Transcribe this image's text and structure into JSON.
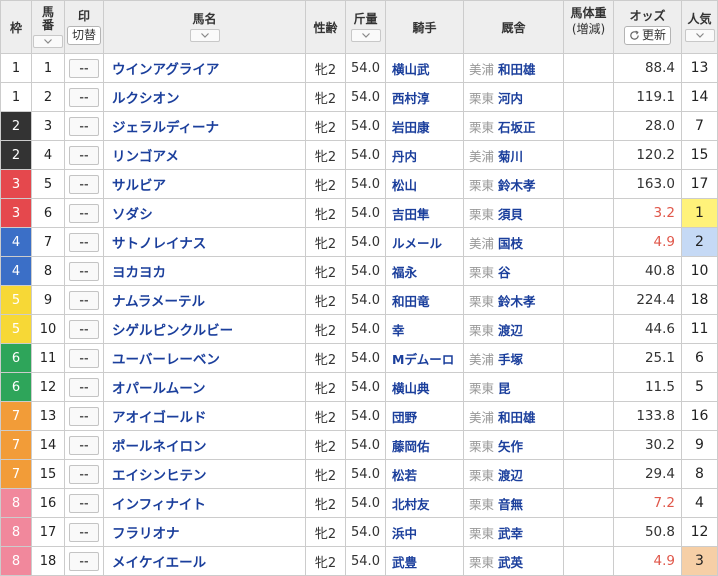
{
  "header": {
    "waku": "枠",
    "umaban": "馬番",
    "mark": "印",
    "mark_toggle": "切替",
    "name": "馬名",
    "sex_age": "性齢",
    "kinryo": "斤量",
    "jockey": "騎手",
    "trainer": "厩舎",
    "weight_l1": "馬体重",
    "weight_l2": "(増減)",
    "odds": "オッズ",
    "refresh": "更新",
    "popularity": "人気"
  },
  "colors": {
    "waku_bg": {
      "1": "#ffffff",
      "2": "#333333",
      "3": "#e5484d",
      "4": "#3b6fc7",
      "5": "#f7d836",
      "6": "#2ea55a",
      "7": "#f29c38",
      "8": "#f1889c"
    },
    "waku_fg": {
      "1": "#222222",
      "2": "#ffffff",
      "3": "#ffffff",
      "4": "#ffffff",
      "5": "#ffffff",
      "6": "#ffffff",
      "7": "#ffffff",
      "8": "#ffffff"
    },
    "pop_bg": {
      "1": "#fff27a",
      "2": "#c5d9f5",
      "3": "#f6cfa6"
    }
  },
  "rows": [
    {
      "waku": "1",
      "umaban": "1",
      "mark": "--",
      "name": "ウインアグライア",
      "sex_age": "牝2",
      "kinryo": "54.0",
      "jockey": "横山武",
      "region": "美浦",
      "trainer": "和田雄",
      "odds": "88.4",
      "pop": "13"
    },
    {
      "waku": "1",
      "umaban": "2",
      "mark": "--",
      "name": "ルクシオン",
      "sex_age": "牝2",
      "kinryo": "54.0",
      "jockey": "西村淳",
      "region": "栗東",
      "trainer": "河内",
      "odds": "119.1",
      "pop": "14"
    },
    {
      "waku": "2",
      "umaban": "3",
      "mark": "--",
      "name": "ジェラルディーナ",
      "sex_age": "牝2",
      "kinryo": "54.0",
      "jockey": "岩田康",
      "region": "栗東",
      "trainer": "石坂正",
      "odds": "28.0",
      "pop": "7"
    },
    {
      "waku": "2",
      "umaban": "4",
      "mark": "--",
      "name": "リンゴアメ",
      "sex_age": "牝2",
      "kinryo": "54.0",
      "jockey": "丹内",
      "region": "美浦",
      "trainer": "菊川",
      "odds": "120.2",
      "pop": "15"
    },
    {
      "waku": "3",
      "umaban": "5",
      "mark": "--",
      "name": "サルビア",
      "sex_age": "牝2",
      "kinryo": "54.0",
      "jockey": "松山",
      "region": "栗東",
      "trainer": "鈴木孝",
      "odds": "163.0",
      "pop": "17"
    },
    {
      "waku": "3",
      "umaban": "6",
      "mark": "--",
      "name": "ソダシ",
      "sex_age": "牝2",
      "kinryo": "54.0",
      "jockey": "吉田隼",
      "region": "栗東",
      "trainer": "須貝",
      "odds": "3.2",
      "pop": "1"
    },
    {
      "waku": "4",
      "umaban": "7",
      "mark": "--",
      "name": "サトノレイナス",
      "sex_age": "牝2",
      "kinryo": "54.0",
      "jockey": "ルメール",
      "region": "美浦",
      "trainer": "国枝",
      "odds": "4.9",
      "pop": "2"
    },
    {
      "waku": "4",
      "umaban": "8",
      "mark": "--",
      "name": "ヨカヨカ",
      "sex_age": "牝2",
      "kinryo": "54.0",
      "jockey": "福永",
      "region": "栗東",
      "trainer": "谷",
      "odds": "40.8",
      "pop": "10"
    },
    {
      "waku": "5",
      "umaban": "9",
      "mark": "--",
      "name": "ナムラメーテル",
      "sex_age": "牝2",
      "kinryo": "54.0",
      "jockey": "和田竜",
      "region": "栗東",
      "trainer": "鈴木孝",
      "odds": "224.4",
      "pop": "18"
    },
    {
      "waku": "5",
      "umaban": "10",
      "mark": "--",
      "name": "シゲルピンクルビー",
      "sex_age": "牝2",
      "kinryo": "54.0",
      "jockey": "幸",
      "region": "栗東",
      "trainer": "渡辺",
      "odds": "44.6",
      "pop": "11"
    },
    {
      "waku": "6",
      "umaban": "11",
      "mark": "--",
      "name": "ユーバーレーベン",
      "sex_age": "牝2",
      "kinryo": "54.0",
      "jockey": "Mデムーロ",
      "region": "美浦",
      "trainer": "手塚",
      "odds": "25.1",
      "pop": "6"
    },
    {
      "waku": "6",
      "umaban": "12",
      "mark": "--",
      "name": "オパールムーン",
      "sex_age": "牝2",
      "kinryo": "54.0",
      "jockey": "横山典",
      "region": "栗東",
      "trainer": "昆",
      "odds": "11.5",
      "pop": "5"
    },
    {
      "waku": "7",
      "umaban": "13",
      "mark": "--",
      "name": "アオイゴールド",
      "sex_age": "牝2",
      "kinryo": "54.0",
      "jockey": "団野",
      "region": "美浦",
      "trainer": "和田雄",
      "odds": "133.8",
      "pop": "16"
    },
    {
      "waku": "7",
      "umaban": "14",
      "mark": "--",
      "name": "ポールネイロン",
      "sex_age": "牝2",
      "kinryo": "54.0",
      "jockey": "藤岡佑",
      "region": "栗東",
      "trainer": "矢作",
      "odds": "30.2",
      "pop": "9"
    },
    {
      "waku": "7",
      "umaban": "15",
      "mark": "--",
      "name": "エイシンヒテン",
      "sex_age": "牝2",
      "kinryo": "54.0",
      "jockey": "松若",
      "region": "栗東",
      "trainer": "渡辺",
      "odds": "29.4",
      "pop": "8"
    },
    {
      "waku": "8",
      "umaban": "16",
      "mark": "--",
      "name": "インフィナイト",
      "sex_age": "牝2",
      "kinryo": "54.0",
      "jockey": "北村友",
      "region": "栗東",
      "trainer": "音無",
      "odds": "7.2",
      "pop": "4"
    },
    {
      "waku": "8",
      "umaban": "17",
      "mark": "--",
      "name": "フラリオナ",
      "sex_age": "牝2",
      "kinryo": "54.0",
      "jockey": "浜中",
      "region": "栗東",
      "trainer": "武幸",
      "odds": "50.8",
      "pop": "12"
    },
    {
      "waku": "8",
      "umaban": "18",
      "mark": "--",
      "name": "メイケイエール",
      "sex_age": "牝2",
      "kinryo": "54.0",
      "jockey": "武豊",
      "region": "栗東",
      "trainer": "武英",
      "odds": "4.9",
      "pop": "3"
    }
  ]
}
